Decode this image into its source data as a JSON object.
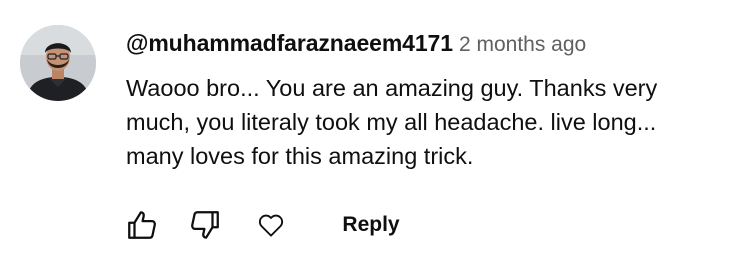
{
  "comment": {
    "author": "@muhammadfaraznaeem4171",
    "timestamp": "2 months ago",
    "text_lines": [
      "Waooo bro... You are an amazing guy. Thanks very",
      "much, you literaly took my all headache. live long...",
      "many loves for this amazing trick."
    ],
    "avatar_icon": "user-avatar"
  },
  "actions": {
    "like_icon": "thumbs-up-icon",
    "dislike_icon": "thumbs-down-icon",
    "heart_icon": "heart-icon",
    "reply_label": "Reply"
  },
  "colors": {
    "text": "#0f0f0f",
    "secondary_text": "#606060",
    "background": "#ffffff"
  }
}
